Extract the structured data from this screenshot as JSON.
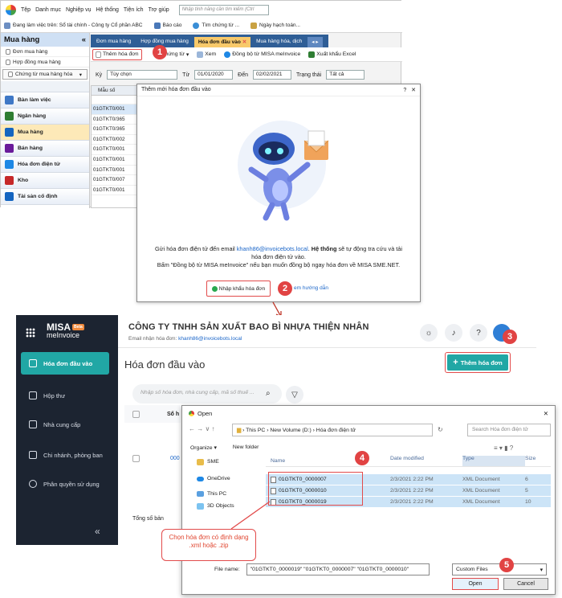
{
  "app": {
    "menu": [
      "Tệp",
      "Danh mục",
      "Nghiệp vụ",
      "Hệ thống",
      "Tiện ích",
      "Trợ giúp"
    ],
    "search_placeholder": "Nhập tính năng cần tìm kiếm (Ctrl",
    "toolbar": [
      "Đang làm việc trên: Sổ tài chính - Công ty Cổ phần ABC",
      "Báo cáo",
      "Tìm chứng từ ...",
      "Ngày hạch toán..."
    ],
    "sidebar": {
      "title": "Mua hàng",
      "collapse": "«",
      "items": [
        "Đơn mua hàng",
        "Hợp đồng mua hàng",
        "Chứng từ mua hàng hóa"
      ],
      "modules": [
        "Bàn làm việc",
        "Ngân hàng",
        "Mua hàng",
        "Bán hàng",
        "Hóa đơn điện tử",
        "Kho",
        "Tài sản cố định"
      ]
    },
    "tabs": [
      "Đơn mua hàng",
      "Hợp đồng mua hàng",
      "Hóa đơn đầu vào",
      "Mua hàng hóa, dịch"
    ],
    "actions": [
      "Thêm hóa đơn",
      "p chứng từ",
      "Xem",
      "Đồng bộ từ MISA meInvoice",
      "Xuất khẩu Excel"
    ],
    "filter": {
      "ky_label": "Kỳ",
      "ky_value": "Tùy chọn",
      "tu_label": "Từ",
      "tu_value": "01/01/2020",
      "den_label": "Đến",
      "den_value": "02/02/2021",
      "status_label": "Trạng thái",
      "status_value": "Tất cả"
    },
    "grid": {
      "header": "Mẫu số",
      "rows": [
        "01GTKT0/001",
        "01GTKT0/365",
        "01GTKT0/365",
        "01GTKT0/002",
        "01GTKT0/001",
        "01GTKT0/001",
        "01GTKT0/001",
        "01GTKT0/007",
        "01GTKT0/001"
      ]
    }
  },
  "modal": {
    "title": "Thêm mới hóa đơn đầu vào",
    "help": "?",
    "close": "✕",
    "text1": "Gửi hóa đơn điện tử đến email ",
    "email": "khanh86@invoicebots.local",
    "text2": ". ",
    "bold": "Hệ thống",
    "text3": " sẽ tự động tra cứu và tải hóa đơn điện tử vào.",
    "text4": "Bấm \"Đồng bộ từ MISA meInvoice\" nếu bạn muốn đồng bộ ngay hóa đơn về MISA SME.NET.",
    "import_btn": "Nhập khẩu hóa đơn",
    "guide": "em hướng dẫn"
  },
  "badges": [
    "1",
    "2",
    "3",
    "4",
    "5"
  ],
  "meinvoice": {
    "brand1": "MISA",
    "brand2": "meInvoice",
    "beta": "Beta",
    "nav": [
      "Hóa đơn đầu vào",
      "Hộp thư",
      "Nhà cung cấp",
      "Chi nhánh, phòng ban",
      "Phân quyền sử dụng"
    ],
    "collapse": "«",
    "company": "CÔNG TY TNHH SẢN XUẤT BAO BÌ NHỰA THIỆN NHÂN",
    "email_label": "Email nhận hóa đơn: ",
    "email": "khanh86@invoicebots.local",
    "page_title": "Hóa đơn đầu vào",
    "add_btn": "Thêm hóa đơn",
    "search_placeholder": "Nhập số hóa đơn, nhà cung cấp, mã số thuế ...",
    "col_so": "Số h",
    "row_fragment": "000",
    "footer": "Tổng số bản"
  },
  "open_dialog": {
    "title": "Open",
    "path": [
      "This PC",
      "New Volume (D:)",
      "Hóa đơn điện tử"
    ],
    "search_placeholder": "Search Hóa đơn điện tử",
    "organize": "Organize ▾",
    "new_folder": "New folder",
    "tree": [
      "SME",
      "OneDrive",
      "This PC",
      "3D Objects"
    ],
    "headers": [
      "Name",
      "Date modified",
      "Type",
      "Size"
    ],
    "files": [
      {
        "name": "01GTKT0_0000007",
        "date": "2/3/2021 2:22 PM",
        "type": "XML Document",
        "size": "6"
      },
      {
        "name": "01GTKT0_0000010",
        "date": "2/3/2021 2:22 PM",
        "type": "XML Document",
        "size": "5"
      },
      {
        "name": "01GTKT0_0000019",
        "date": "2/3/2021 2:22 PM",
        "type": "XML Document",
        "size": "10"
      }
    ],
    "file_name_label": "File name:",
    "file_name_value": "\"01GTKT0_0000019\" \"01GTKT0_0000007\" \"01GTKT0_0000010\"",
    "file_type": "Custom Files",
    "open": "Open",
    "cancel": "Cancel"
  },
  "callout": "Chọn hóa đơn có định dạng .xml hoặc .zip",
  "colors": {
    "teal": "#21a7a5",
    "red": "#e24b4b",
    "navy": "#1c2431",
    "tabbar": "#2f5e96"
  }
}
